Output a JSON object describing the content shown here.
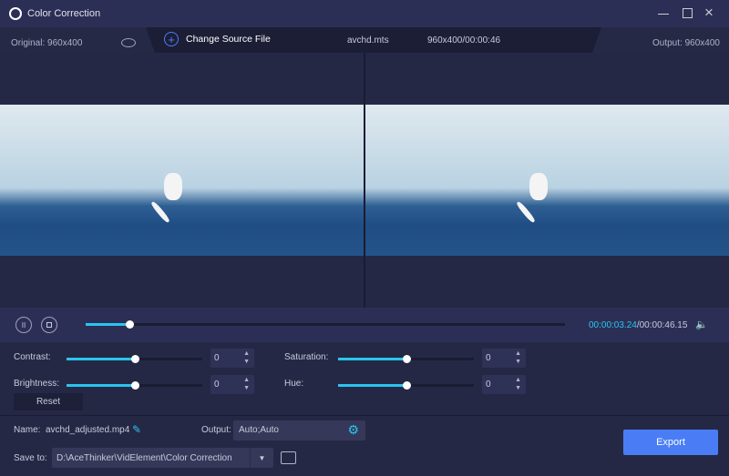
{
  "window": {
    "title": "Color Correction",
    "icon": "app-logo-icon"
  },
  "infobar": {
    "original": "Original: 960x400",
    "change_source": "Change Source File",
    "filename": "avchd.mts",
    "file_info": "960x400/00:00:46",
    "output": "Output: 960x400"
  },
  "playback": {
    "current": "00:00:03.24",
    "total": "/00:00:46.15",
    "progress_fraction": 0.091
  },
  "adjust": {
    "contrast": {
      "label": "Contrast:",
      "value": "0",
      "slider_fraction": 0.5
    },
    "saturation": {
      "label": "Saturation:",
      "value": "0",
      "slider_fraction": 0.5
    },
    "brightness": {
      "label": "Brightness:",
      "value": "0",
      "slider_fraction": 0.5
    },
    "hue": {
      "label": "Hue:",
      "value": "0",
      "slider_fraction": 0.5
    },
    "reset": "Reset"
  },
  "bottom": {
    "name_label": "Name:",
    "name_value": "avchd_adjusted.mp4",
    "output_label": "Output:",
    "output_value": "Auto;Auto",
    "save_label": "Save to:",
    "save_path": "D:\\AceThinker\\VidElement\\Color Correction",
    "export": "Export"
  },
  "colors": {
    "accent": "#29c5f0",
    "export": "#4a7df5"
  }
}
